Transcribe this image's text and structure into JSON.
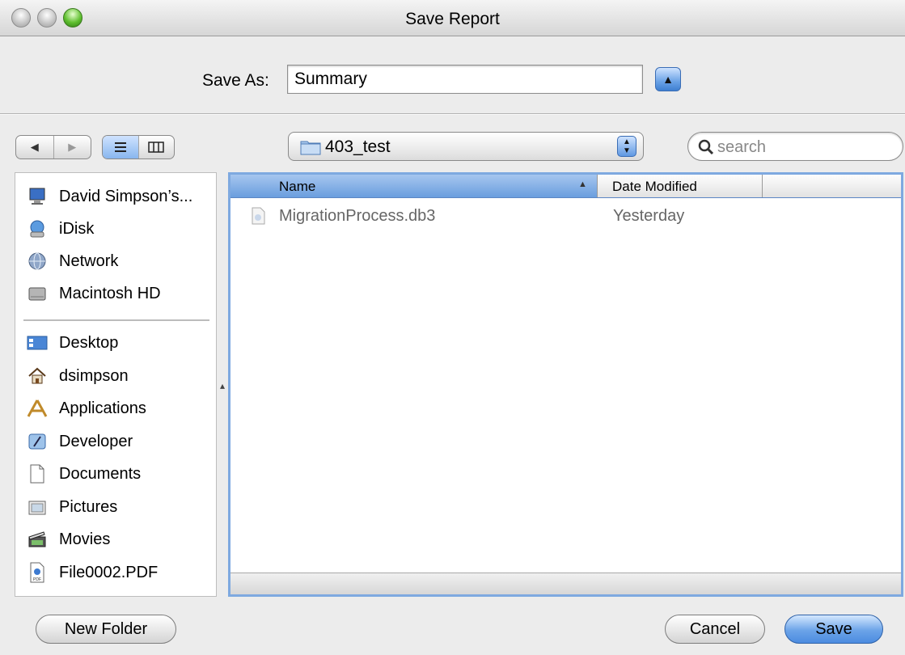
{
  "window": {
    "title": "Save Report",
    "traffic_lights": [
      "close",
      "minimize",
      "zoom"
    ]
  },
  "save_as": {
    "label": "Save As:",
    "value": "Summary",
    "expand_icon": "triangle-up-icon"
  },
  "toolbar": {
    "back_icon": "back-arrow-icon",
    "forward_icon": "forward-arrow-icon",
    "view_list_icon": "list-view-icon",
    "view_column_icon": "column-view-icon",
    "current_folder": "403_test",
    "search_placeholder": "search"
  },
  "sidebar": {
    "devices": [
      {
        "label": "David Simpson’s...",
        "icon": "computer-icon"
      },
      {
        "label": "iDisk",
        "icon": "idisk-icon"
      },
      {
        "label": "Network",
        "icon": "network-icon"
      },
      {
        "label": "Macintosh HD",
        "icon": "hard-drive-icon"
      }
    ],
    "places": [
      {
        "label": "Desktop",
        "icon": "desktop-icon"
      },
      {
        "label": "dsimpson",
        "icon": "home-icon"
      },
      {
        "label": "Applications",
        "icon": "applications-icon"
      },
      {
        "label": "Developer",
        "icon": "developer-icon"
      },
      {
        "label": "Documents",
        "icon": "documents-icon"
      },
      {
        "label": "Pictures",
        "icon": "pictures-icon"
      },
      {
        "label": "Movies",
        "icon": "movies-icon"
      },
      {
        "label": "File0002.PDF",
        "icon": "pdf-icon"
      }
    ]
  },
  "file_list": {
    "columns": [
      "Name",
      "Date Modified"
    ],
    "sort_column": "Name",
    "rows": [
      {
        "name": "MigrationProcess.db3",
        "date": "Yesterday",
        "icon": "database-file-icon"
      }
    ]
  },
  "buttons": {
    "new_folder": "New Folder",
    "cancel": "Cancel",
    "save": "Save"
  },
  "colors": {
    "accent_blue": "#6aa2e6",
    "selection_header": "#88b6ee",
    "window_bg": "#ececec"
  }
}
